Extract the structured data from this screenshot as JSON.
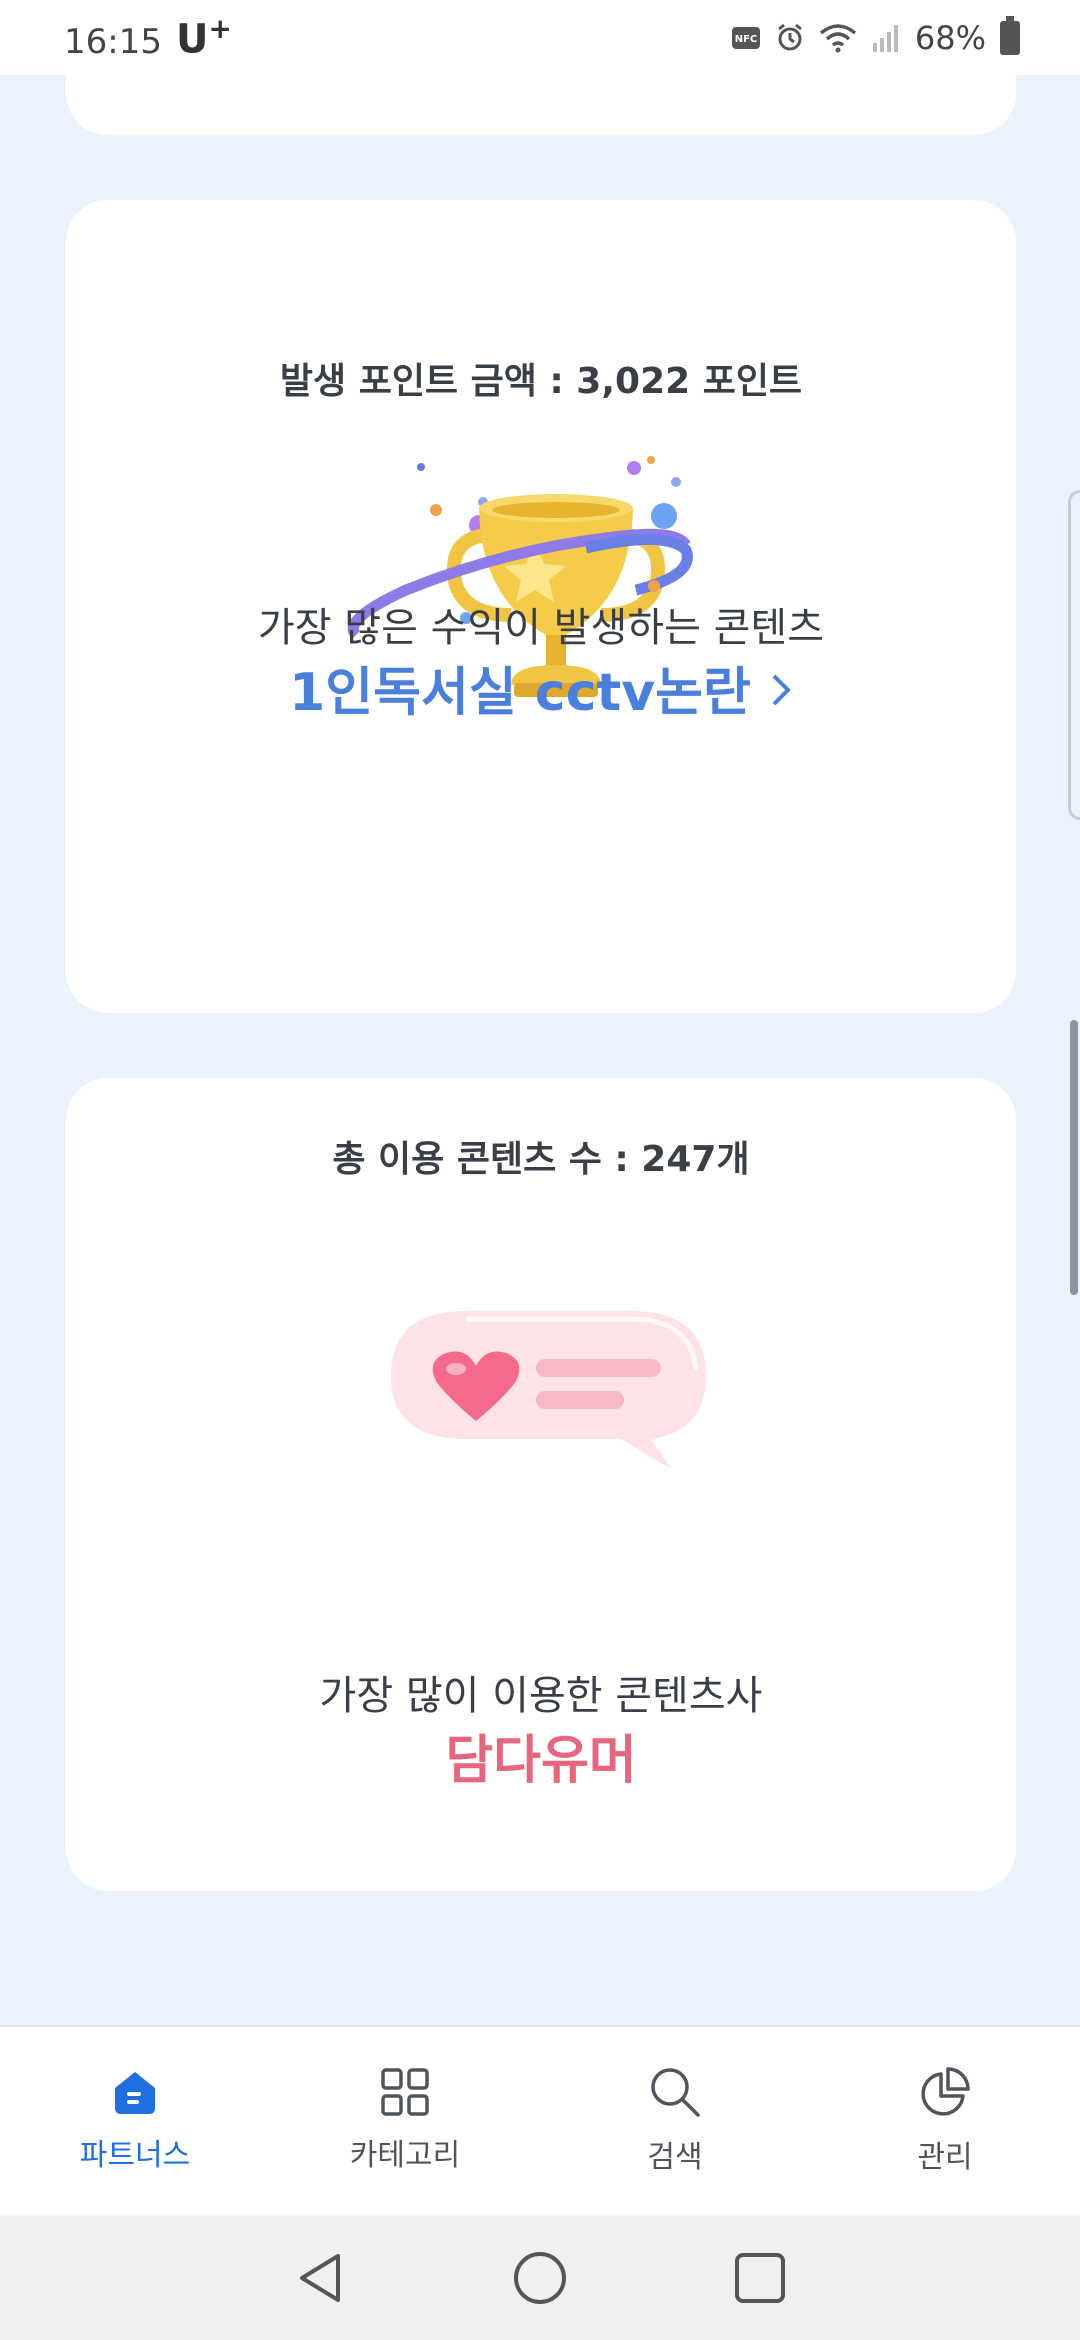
{
  "status": {
    "time": "16:15",
    "carrier": "U",
    "carrier_sup": "+",
    "battery": "68%"
  },
  "points_card": {
    "heading": "발생 포인트 금액 : 3,022 포인트",
    "subtitle": "가장 많은 수익이 발생하는 콘텐츠",
    "top_content": "1인독서실 cctv논란"
  },
  "usage_card": {
    "heading": "총 이용 콘텐츠 수 : 247개",
    "subtitle": "가장 많이 이용한 콘텐츠사",
    "top_provider": "담다유머"
  },
  "bottom_nav": {
    "items": [
      {
        "label": "파트너스",
        "icon": "partners-home-icon",
        "active": true
      },
      {
        "label": "카테고리",
        "icon": "category-grid-icon",
        "active": false
      },
      {
        "label": "검색",
        "icon": "search-icon",
        "active": false
      },
      {
        "label": "관리",
        "icon": "pie-chart-icon",
        "active": false
      }
    ]
  },
  "colors": {
    "accent_blue": "#1f6fe0",
    "link_blue": "#4b7fdd",
    "highlight_pink": "#e8657e",
    "background": "#eaf3fd"
  }
}
